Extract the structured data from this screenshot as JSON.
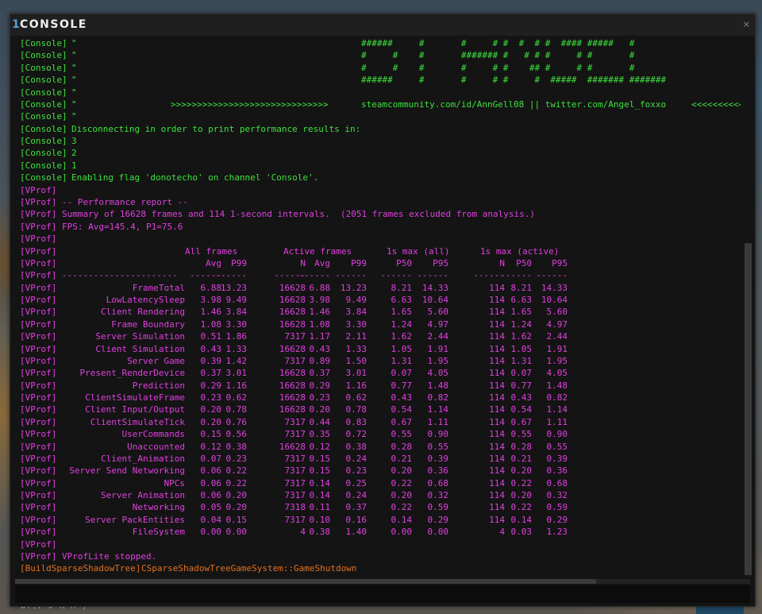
{
  "window": {
    "title_number": "1",
    "title": "CONSOLE",
    "close_glyph": "×"
  },
  "console_lines": [
    {
      "tag": "[Console]",
      "text": "\"",
      "extra": "######     #       #     # #  #  # #  #### #####   #"
    },
    {
      "tag": "[Console]",
      "text": "\"",
      "extra": "#     #    #       ####### #   # # #     # #       #"
    },
    {
      "tag": "[Console]",
      "text": "\"",
      "extra": "#     #    #       #     # #    ## #     # #       #"
    },
    {
      "tag": "[Console]",
      "text": "\"",
      "extra": "######     #       #     # #     #  #####  ####### #######"
    },
    {
      "tag": "[Console]",
      "text": "\"",
      "extra": ""
    },
    {
      "tag": "[Console]",
      "text": "\"",
      "arrows_left": ">>>>>>>>>>>>>>>>>>>>>>>>>>>>>>",
      "extra": "steamcommunity.com/id/AnnGell08 || twitter.com/Angel_foxxo",
      "arrows_right": "<<<<<<<<<<<<"
    },
    {
      "tag": "[Console]",
      "text": "\"",
      "extra": ""
    },
    {
      "tag": "[Console]",
      "text": "Disconnecting in order to print performance results in:",
      "extra": ""
    },
    {
      "tag": "[Console]",
      "text": "3",
      "extra": ""
    },
    {
      "tag": "[Console]",
      "text": "2",
      "extra": ""
    },
    {
      "tag": "[Console]",
      "text": "1",
      "extra": ""
    },
    {
      "tag": "[Console]",
      "text": "Enabling flag 'donotecho' on channel 'Console'.",
      "extra": ""
    }
  ],
  "vprof_header_lines": [
    {
      "tag": "[VProf]",
      "text": ""
    },
    {
      "tag": "[VProf]",
      "text": "-- Performance report --"
    },
    {
      "tag": "[VProf]",
      "text": "Summary of 16628 frames and 114 1-second intervals.  (2051 frames excluded from analysis.)"
    },
    {
      "tag": "[VProf]",
      "text": "FPS: Avg=145.4, P1=75.6"
    },
    {
      "tag": "[VProf]",
      "text": ""
    }
  ],
  "table": {
    "tag": "[VProf]",
    "group_headers": [
      "All frames",
      "Active frames",
      "1s max (all)",
      "1s max (active)"
    ],
    "column_headers": [
      "Avg",
      "P99",
      "N",
      "Avg",
      "P99",
      "P50",
      "P95",
      "N",
      "P50",
      "P95"
    ],
    "separator_name": "----------------------",
    "separator_col": "------",
    "rows": [
      {
        "name": "FrameTotal",
        "values": [
          "6.88",
          "13.23",
          "16628",
          "6.88",
          "13.23",
          "8.21",
          "14.33",
          "114",
          "8.21",
          "14.33"
        ]
      },
      {
        "name": "LowLatencySleep",
        "values": [
          "3.98",
          "9.49",
          "16628",
          "3.98",
          "9.49",
          "6.63",
          "10.64",
          "114",
          "6.63",
          "10.64"
        ]
      },
      {
        "name": "Client Rendering",
        "values": [
          "1.46",
          "3.84",
          "16628",
          "1.46",
          "3.84",
          "1.65",
          "5.60",
          "114",
          "1.65",
          "5.60"
        ]
      },
      {
        "name": "Frame Boundary",
        "values": [
          "1.08",
          "3.30",
          "16628",
          "1.08",
          "3.30",
          "1.24",
          "4.97",
          "114",
          "1.24",
          "4.97"
        ]
      },
      {
        "name": "Server Simulation",
        "values": [
          "0.51",
          "1.86",
          "7317",
          "1.17",
          "2.11",
          "1.62",
          "2.44",
          "114",
          "1.62",
          "2.44"
        ]
      },
      {
        "name": "Client Simulation",
        "values": [
          "0.43",
          "1.33",
          "16628",
          "0.43",
          "1.33",
          "1.05",
          "1.91",
          "114",
          "1.05",
          "1.91"
        ]
      },
      {
        "name": "Server Game",
        "values": [
          "0.39",
          "1.42",
          "7317",
          "0.89",
          "1.50",
          "1.31",
          "1.95",
          "114",
          "1.31",
          "1.95"
        ]
      },
      {
        "name": "Present_RenderDevice",
        "values": [
          "0.37",
          "3.01",
          "16628",
          "0.37",
          "3.01",
          "0.07",
          "4.05",
          "114",
          "0.07",
          "4.05"
        ]
      },
      {
        "name": "Prediction",
        "values": [
          "0.29",
          "1.16",
          "16628",
          "0.29",
          "1.16",
          "0.77",
          "1.48",
          "114",
          "0.77",
          "1.48"
        ]
      },
      {
        "name": "ClientSimulateFrame",
        "values": [
          "0.23",
          "0.62",
          "16628",
          "0.23",
          "0.62",
          "0.43",
          "0.82",
          "114",
          "0.43",
          "0.82"
        ]
      },
      {
        "name": "Client Input/Output",
        "values": [
          "0.20",
          "0.78",
          "16628",
          "0.20",
          "0.78",
          "0.54",
          "1.14",
          "114",
          "0.54",
          "1.14"
        ]
      },
      {
        "name": "ClientSimulateTick",
        "values": [
          "0.20",
          "0.76",
          "7317",
          "0.44",
          "0.83",
          "0.67",
          "1.11",
          "114",
          "0.67",
          "1.11"
        ]
      },
      {
        "name": "UserCommands",
        "values": [
          "0.15",
          "0.56",
          "7317",
          "0.35",
          "0.72",
          "0.55",
          "0.90",
          "114",
          "0.55",
          "0.90"
        ]
      },
      {
        "name": "Unaccounted",
        "values": [
          "0.12",
          "0.38",
          "16628",
          "0.12",
          "0.38",
          "0.28",
          "0.55",
          "114",
          "0.28",
          "0.55"
        ]
      },
      {
        "name": "Client_Animation",
        "values": [
          "0.07",
          "0.23",
          "7317",
          "0.15",
          "0.24",
          "0.21",
          "0.39",
          "114",
          "0.21",
          "0.39"
        ]
      },
      {
        "name": "Server Send Networking",
        "values": [
          "0.06",
          "0.22",
          "7317",
          "0.15",
          "0.23",
          "0.20",
          "0.36",
          "114",
          "0.20",
          "0.36"
        ]
      },
      {
        "name": "NPCs",
        "values": [
          "0.06",
          "0.22",
          "7317",
          "0.14",
          "0.25",
          "0.22",
          "0.68",
          "114",
          "0.22",
          "0.68"
        ]
      },
      {
        "name": "Server Animation",
        "values": [
          "0.06",
          "0.20",
          "7317",
          "0.14",
          "0.24",
          "0.20",
          "0.32",
          "114",
          "0.20",
          "0.32"
        ]
      },
      {
        "name": "Networking",
        "values": [
          "0.05",
          "0.20",
          "7318",
          "0.11",
          "0.37",
          "0.22",
          "0.59",
          "114",
          "0.22",
          "0.59"
        ]
      },
      {
        "name": "Server PackEntities",
        "values": [
          "0.04",
          "0.15",
          "7317",
          "0.10",
          "0.16",
          "0.14",
          "0.29",
          "114",
          "0.14",
          "0.29"
        ]
      },
      {
        "name": "FileSystem",
        "values": [
          "0.00",
          "0.00",
          "4",
          "0.38",
          "1.40",
          "0.00",
          "0.00",
          "4",
          "0.03",
          "1.23"
        ]
      }
    ]
  },
  "footer_lines": [
    {
      "tag": "[VProf]",
      "text": "",
      "color": "vprof"
    },
    {
      "tag": "[VProf]",
      "text": "VProfLite stopped.",
      "color": "vprof"
    },
    {
      "tag": "[BuildSparseShadowTree]",
      "text": "CSparseShadowTreeGameSystem::GameShutdown",
      "color": "orange"
    }
  ],
  "background": {
    "hud_text": "WT.7 # R A )"
  },
  "colors": {
    "console": "#3de23d",
    "vprof": "#e040e0",
    "orange": "#e07020",
    "accent": "#4aa3e0"
  }
}
